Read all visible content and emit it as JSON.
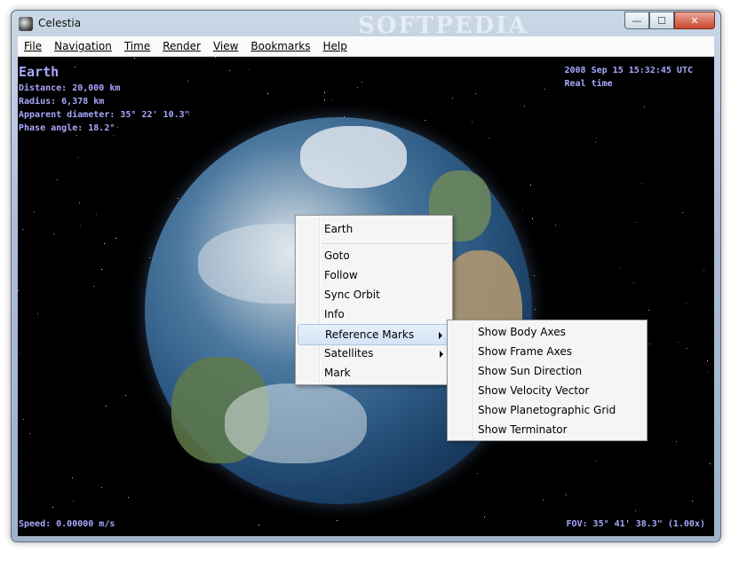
{
  "window": {
    "title": "Celestia",
    "watermark": "SOFTPEDIA"
  },
  "controls": {
    "minimize": "—",
    "maximize": "☐",
    "close": "✕"
  },
  "menubar": [
    {
      "label": "File"
    },
    {
      "label": "Navigation"
    },
    {
      "label": "Time"
    },
    {
      "label": "Render"
    },
    {
      "label": "View"
    },
    {
      "label": "Bookmarks"
    },
    {
      "label": "Help"
    }
  ],
  "context_menu": {
    "items": [
      {
        "label": "Earth"
      },
      {
        "label": "Goto"
      },
      {
        "label": "Follow"
      },
      {
        "label": "Sync Orbit"
      },
      {
        "label": "Info"
      },
      {
        "label": "Reference Marks"
      },
      {
        "label": "Satellites"
      },
      {
        "label": "Mark"
      }
    ]
  },
  "submenu": {
    "items": [
      {
        "label": "Show Body Axes"
      },
      {
        "label": "Show Frame Axes"
      },
      {
        "label": "Show Sun Direction"
      },
      {
        "label": "Show Velocity Vector"
      },
      {
        "label": "Show Planetographic Grid"
      },
      {
        "label": "Show Terminator"
      }
    ]
  },
  "hud": {
    "body_name": "Earth",
    "info_lines": [
      "Distance: 20,000 km",
      "Radius: 6,378 km",
      "Apparent diameter: 35° 22' 10.3\"",
      "Phase angle: 18.2°"
    ],
    "datetime": "2008 Sep 15 15:32:45 UTC",
    "time_rate": "Real time",
    "speed": "Speed: 0.00000 m/s",
    "fov": "FOV: 35° 41' 38.3\" (1.00x)"
  }
}
